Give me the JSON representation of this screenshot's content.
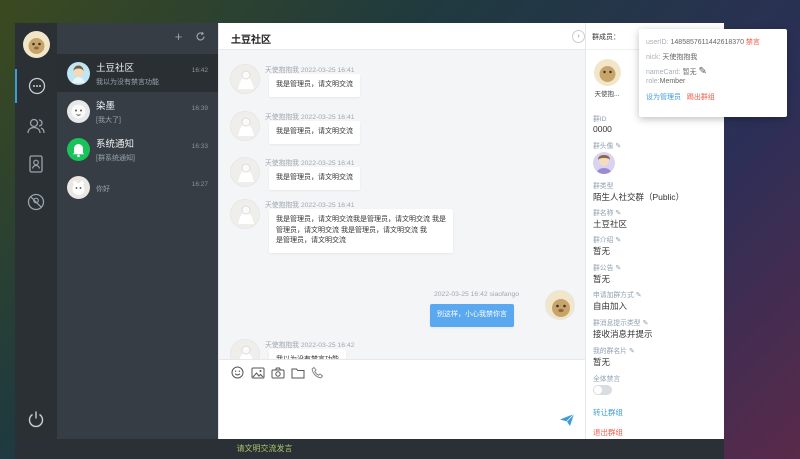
{
  "nav": {
    "icons": [
      "conversation-icon",
      "contacts-icon",
      "address-book-icon",
      "blocked-user-icon",
      "power-icon"
    ]
  },
  "conversations": [
    {
      "name": "土豆社区",
      "last": "我以为没有禁言功能",
      "time": "16:42",
      "avatar_color": "#bfe6f3"
    },
    {
      "name": "染墨",
      "last": "[我大了]",
      "time": "16:39",
      "avatar_color": "#e8e8e8"
    },
    {
      "name": "系统通知",
      "last": "[群系统通知]",
      "time": "16:33",
      "avatar_color": "#19c35a"
    },
    {
      "name": "",
      "last": "你好",
      "time": "16:27",
      "avatar_color": "#ebe7e2"
    }
  ],
  "chat": {
    "title": "土豆社区",
    "messages": [
      {
        "meta": "天使抱抱我 2022-03-25 16:41",
        "lines": [
          "我是管理员，请文明交流"
        ]
      },
      {
        "meta": "天使抱抱我 2022-03-25 16:41",
        "lines": [
          "我是管理员，请文明交流"
        ]
      },
      {
        "meta": "天使抱抱我 2022-03-25 16:41",
        "lines": [
          "我是管理员，请文明交流"
        ]
      },
      {
        "meta": "天使抱抱我 2022-03-25 16:41",
        "lines": [
          "我是管理员，请文明交流我是管理员，请文明交流 我是",
          "管理员，请文明交流 我是管理员，请文明交流 我",
          "是管理员，请文明交流"
        ]
      },
      {
        "meta": "2022-03-25 16:42 siaofango",
        "lines": [
          "别这样，小心我禁你言"
        ],
        "self": true
      },
      {
        "meta": "天使抱抱我 2022-03-25 16:42",
        "lines": [
          "我以为没有禁言功能"
        ]
      }
    ],
    "composer_icons": [
      "emoji-icon",
      "image-icon",
      "camera-icon",
      "folder-icon",
      "call-icon"
    ]
  },
  "panel": {
    "members_label": "群成员：",
    "member_name": "天使抱...",
    "group_id_label": "群ID",
    "group_id": "0000",
    "avatar_label": "群头像",
    "type_label": "群类型",
    "type_value": "陌生人社交群（Public）",
    "name_label": "群名称",
    "name_value": "土豆社区",
    "intro_label": "群介绍",
    "intro_value": "暂无",
    "notice_label": "群公告",
    "notice_value": "暂无",
    "join_label": "申请加群方式",
    "join_value": "自由加入",
    "prompt_label": "群消息提示类型",
    "prompt_value": "接收消息并提示",
    "card_label": "我的群名片",
    "card_value": "暂无",
    "mute_all_label": "全体禁言",
    "transfer_label": "转让群组",
    "quit_label": "退出群组"
  },
  "popup": {
    "userid_label": "userID:",
    "userid": "1485857611442618370",
    "mute": "禁言",
    "nick_label": "nick:",
    "nick": "天使抱抱我",
    "namecard_label": "nameCard:",
    "namecard": "暂无",
    "role_label": "role:",
    "role": "Member",
    "set_admin": "设为管理员",
    "kick": "踢出群组"
  },
  "bottom_notice": "请文明交流发言",
  "colors": {
    "accent": "#3d9bd9",
    "danger": "#f25a4a",
    "bubble_self": "#5aa8f0"
  }
}
